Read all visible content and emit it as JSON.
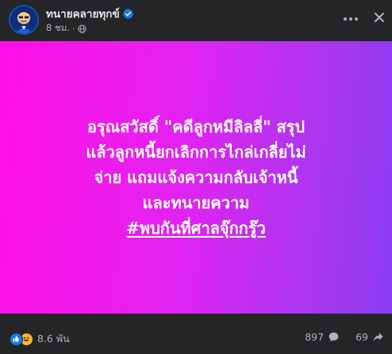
{
  "post": {
    "author": "ทนายคลายทุกข์",
    "time": "8 ชม.",
    "separator": "·",
    "verified_icon": "verified-badge-icon",
    "privacy_icon": "globe-icon"
  },
  "card": {
    "lines": [
      "อรุณสวัสดิ์ \"คดีลูกหมีลิลลี่\" สรุป",
      "แล้วลูกหนี้ยกเลิกการไกล่เกลี่ยไม่",
      "จ่าย แถมแจ้งความกลับเจ้าหนี้",
      "และทนายความ"
    ],
    "hashtag": "#พบกันที่ศาลจุ๊กกรู๊ว",
    "gradient_colors": [
      "#ff10e6",
      "#e322f0",
      "#b234f0",
      "#8a3df0"
    ],
    "text_color": "#ffffff"
  },
  "footer": {
    "reaction_count": "8.6 พัน",
    "comment_count": "897",
    "share_count": "69",
    "reaction_icons": [
      "like-icon",
      "haha-icon"
    ]
  },
  "colors": {
    "background": "#242526",
    "primary_text": "#e4e6eb",
    "secondary_text": "#b0b3b8",
    "accent": "#1877f2"
  }
}
